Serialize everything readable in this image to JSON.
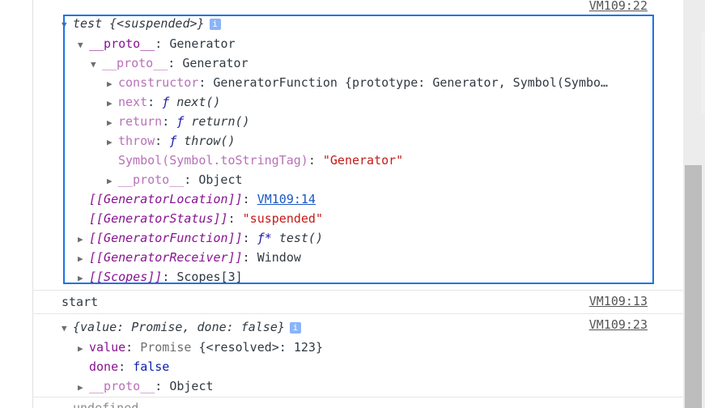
{
  "sources": {
    "top": "VM109:22",
    "start": "VM109:13",
    "obj": "VM109:23"
  },
  "generator": {
    "summary_name": "test",
    "summary_state": "{<suspended>}",
    "info_glyph": "i",
    "proto1_key": "__proto__",
    "proto1_val": "Generator",
    "proto2_key": "__proto__",
    "proto2_val": "Generator",
    "constructor_key": "constructor",
    "constructor_val": "GeneratorFunction {prototype: Generator, Symbol(Symbo…",
    "next_key": "next",
    "next_f": "ƒ",
    "next_val": "next()",
    "return_key": "return",
    "return_f": "ƒ",
    "return_val": "return()",
    "throw_key": "throw",
    "throw_f": "ƒ",
    "throw_val": "throw()",
    "tag_key": "Symbol(Symbol.toStringTag)",
    "tag_val": "\"Generator\"",
    "proto3_key": "__proto__",
    "proto3_val": "Object",
    "location_key": "[[GeneratorLocation]]",
    "location_val": "VM109:14",
    "status_key": "[[GeneratorStatus]]",
    "status_val": "\"suspended\"",
    "function_key": "[[GeneratorFunction]]",
    "function_f": "ƒ*",
    "function_val": "test()",
    "receiver_key": "[[GeneratorReceiver]]",
    "receiver_val": "Window",
    "scopes_key": "[[Scopes]]",
    "scopes_val": "Scopes[3]"
  },
  "start_msg": "start",
  "result": {
    "summary": "{value: Promise, done: false}",
    "value_key": "value",
    "value_type": "Promise",
    "value_detail": "{<resolved>: 123}",
    "done_key": "done",
    "done_val": "false",
    "proto_key": "__proto__",
    "proto_val": "Object"
  },
  "partial_line": "undefined",
  "colors": {
    "highlight": "#1a73e8",
    "purple": "#881391",
    "string_red": "#c41a16",
    "link_blue": "#1a57c2"
  }
}
